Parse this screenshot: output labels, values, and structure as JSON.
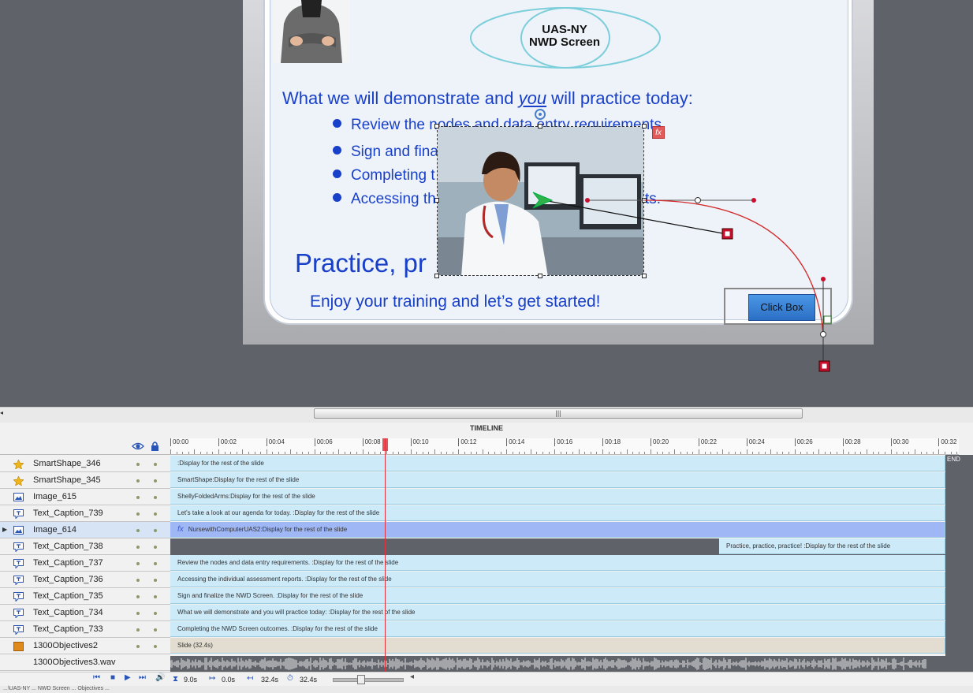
{
  "slide": {
    "venn_title": "UAS-NY\nNWD Screen",
    "heading_before": "What we will demonstrate and ",
    "heading_you": "you",
    "heading_after": " will practice today:",
    "bullets": [
      "Review the nodes and data entry requirements.",
      "Sign and fina",
      "Completing t",
      "Accessing th"
    ],
    "bullet_tail": "ts.",
    "practice": "Practice, pr",
    "enjoy": "Enjoy your training and let’s get started!",
    "click_box": "Click Box",
    "fx_badge": "fx"
  },
  "timeline": {
    "title": "TIMELINE",
    "ruler_ticks": [
      "00:00",
      "00:02",
      "00:04",
      "00:06",
      "00:08",
      "00:10",
      "00:12",
      "00:14",
      "00:16",
      "00:18",
      "00:20",
      "00:22",
      "00:24",
      "00:26",
      "00:28",
      "00:30",
      "00:32"
    ],
    "end_label": "END",
    "layers": [
      {
        "name": "SmartShape_346",
        "icon": "star-icon",
        "bar": "  :Display for the rest of the slide"
      },
      {
        "name": "SmartShape_345",
        "icon": "star-icon",
        "bar": "SmartShape:Display for the rest of the slide"
      },
      {
        "name": "Image_615",
        "icon": "image-icon",
        "bar": "ShellyFoldedArms:Display for the rest of the slide"
      },
      {
        "name": "Text_Caption_739",
        "icon": "caption-icon",
        "bar": "Let's take a look at our agenda for today.  :Display for the rest of the slide"
      },
      {
        "name": "Image_614",
        "icon": "image-icon",
        "bar": "NursewithComputerUAS2:Display for the rest of the slide",
        "fx": "fx"
      },
      {
        "name": "Text_Caption_738",
        "icon": "caption-icon",
        "bar": "Practice, practice, practice! :Display for the rest of the slide"
      },
      {
        "name": "Text_Caption_737",
        "icon": "caption-icon",
        "bar": "Review the nodes and data entry requirements. :Display for the rest of the slide"
      },
      {
        "name": "Text_Caption_736",
        "icon": "caption-icon",
        "bar": "Accessing the individual assessment reports. :Display for the rest of the slide"
      },
      {
        "name": "Text_Caption_735",
        "icon": "caption-icon",
        "bar": "Sign and finalize the NWD Screen. :Display for the rest of the slide"
      },
      {
        "name": "Text_Caption_734",
        "icon": "caption-icon",
        "bar": "What we will demonstrate and you will practice today: :Display for the rest of the slide"
      },
      {
        "name": "Text_Caption_733",
        "icon": "caption-icon",
        "bar": "Completing the NWD Screen outcomes. :Display for the rest of the slide"
      },
      {
        "name": "1300Objectives2",
        "icon": "slide-icon",
        "bar": "Slide (32.4s)"
      },
      {
        "name": "1300Objectives3.wav",
        "icon": "audio-icon",
        "bar": ""
      }
    ],
    "playhead_time": "9.0s",
    "start_time": "0.0s",
    "duration": "32.4s",
    "end_time": "32.4s"
  },
  "statusbar": {
    "path": "...\\UAS-NY ... NWD Screen ... Objectives ..."
  }
}
